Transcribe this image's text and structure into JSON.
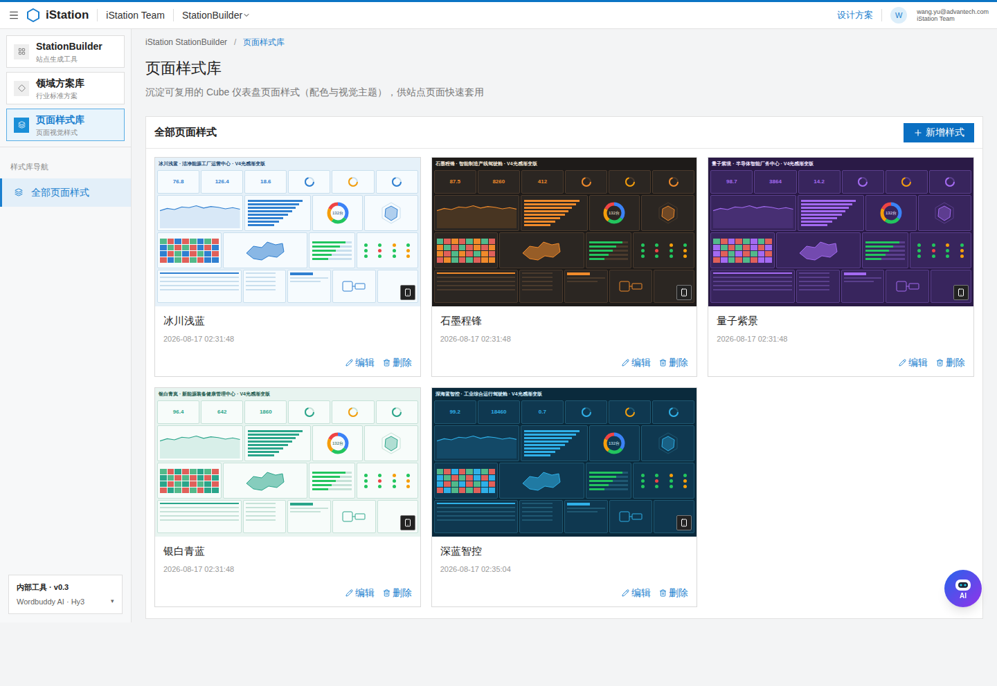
{
  "topbar": {
    "brand": "iStation",
    "team": "iStation Team",
    "product": "StationBuilder",
    "link": "设计方案",
    "avatar": "W",
    "email": "wang.yu@advantech.com",
    "org": "iStation Team"
  },
  "sidebar": {
    "modules": [
      {
        "title": "StationBuilder",
        "subtitle": "站点生成工具",
        "selected": false
      },
      {
        "title": "领域方案库",
        "subtitle": "行业标准方案",
        "selected": false
      },
      {
        "title": "页面样式库",
        "subtitle": "页面视觉样式",
        "selected": true
      }
    ],
    "section": "样式库导航",
    "nav": [
      {
        "label": "全部页面样式",
        "selected": true
      }
    ],
    "footer": {
      "title": "内部工具 · v0.3",
      "subtitle": "Wordbuddy AI · Hy3",
      "caret": "▾"
    }
  },
  "breadcrumb": {
    "items": [
      "iStation StationBuilder",
      "页面样式库"
    ],
    "separator": "/"
  },
  "page": {
    "title": "页面样式库",
    "subtitle": "沉淀可复用的 Cube 仪表盘页面样式（配色与视觉主题），供站点页面快速套用"
  },
  "panel": {
    "title": "全部页面样式",
    "add_button": "新增样式"
  },
  "actions": [
    "编辑",
    "删除"
  ],
  "thumbnail_charts": {
    "line": [
      42,
      48,
      45,
      52,
      50,
      55,
      49,
      53,
      51,
      47,
      50,
      46
    ],
    "bars": [
      92,
      86,
      80,
      74,
      68,
      60,
      52,
      44
    ],
    "progress": [
      0.85,
      0.7,
      0.6,
      0.5,
      0.4
    ],
    "heatmap": [
      0.2,
      0.8,
      0.5,
      0.9,
      0.3,
      0.6,
      0.1,
      0.7,
      0.6,
      0.3,
      0.9,
      0.2,
      0.7,
      0.4,
      0.8,
      0.5,
      0.4,
      0.7,
      0.2,
      0.6,
      0.9,
      0.1,
      0.5,
      0.8,
      0.9,
      0.5,
      0.3,
      0.8,
      0.2,
      0.7,
      0.6,
      0.4
    ],
    "donut": [
      {
        "value": 35,
        "color": "#3b82f6"
      },
      {
        "value": 25,
        "color": "#22c55e"
      },
      {
        "value": 22,
        "color": "#f59e0b"
      },
      {
        "value": 18,
        "color": "#ef4444"
      }
    ],
    "dots": [
      "#22c55e",
      "#22c55e",
      "#f59e0b",
      "#22c55e",
      "#22c55e",
      "#ef4444",
      "#22c55e",
      "#f59e0b",
      "#22c55e",
      "#22c55e",
      "#22c55e",
      "#f59e0b"
    ]
  },
  "styles": [
    {
      "name": "冰川浅蓝",
      "date": "2026-08-17 02:31:48",
      "title": "冰川浅蓝 · 洁净能源工厂运营中心 · V4光感渐变版",
      "kpis": [
        "76.8",
        "126.4",
        "18.6"
      ],
      "donut_label": "132台",
      "theme": {
        "bg": "#e6f1f9",
        "panel": "#f6fbfe",
        "border": "#c9dfee",
        "accent": "#2f7fd0",
        "text": "#1e4a73"
      }
    },
    {
      "name": "石墨程锋",
      "date": "2026-08-17 02:31:48",
      "title": "石墨程锋 · 智能制造产线驾驶舱 · V4光感渐变版",
      "kpis": [
        "87.5",
        "8260",
        "412"
      ],
      "donut_label": "132台",
      "theme": {
        "bg": "#1e1b19",
        "panel": "#2b2622",
        "border": "#4a3a2c",
        "accent": "#f08a2b",
        "text": "#f3e6d8"
      }
    },
    {
      "name": "量子紫景",
      "date": "2026-08-17 02:31:48",
      "title": "量子紫境 · 半导体智能厂务中心 · V4光感渐变版",
      "kpis": [
        "98.7",
        "3864",
        "14.2"
      ],
      "donut_label": "132台",
      "theme": {
        "bg": "#2a1a46",
        "panel": "#38255d",
        "border": "#5a3f8c",
        "accent": "#a46af2",
        "text": "#efe3ff"
      }
    },
    {
      "name": "银白青蓝",
      "date": "2026-08-17 02:31:48",
      "title": "银白青岚 · 新能源装备健康管理中心 · V4光感渐变版",
      "kpis": [
        "96.4",
        "642",
        "1860"
      ],
      "donut_label": "132台",
      "theme": {
        "bg": "#e8f4f0",
        "panel": "#f7fcfa",
        "border": "#c6e2d8",
        "accent": "#2aa58a",
        "text": "#1b5a4d"
      }
    },
    {
      "name": "深蓝智控",
      "date": "2026-08-17 02:35:04",
      "title": "深海蓝智控 · 工业综合运行驾驶舱 · V4光感渐变版",
      "kpis": [
        "99.2",
        "18460",
        "0.7"
      ],
      "donut_label": "132台",
      "theme": {
        "bg": "#0a2a3c",
        "panel": "#0f3850",
        "border": "#1f5872",
        "accent": "#2fb0e8",
        "text": "#d8f1ff"
      }
    }
  ],
  "ai_badge": "AI"
}
